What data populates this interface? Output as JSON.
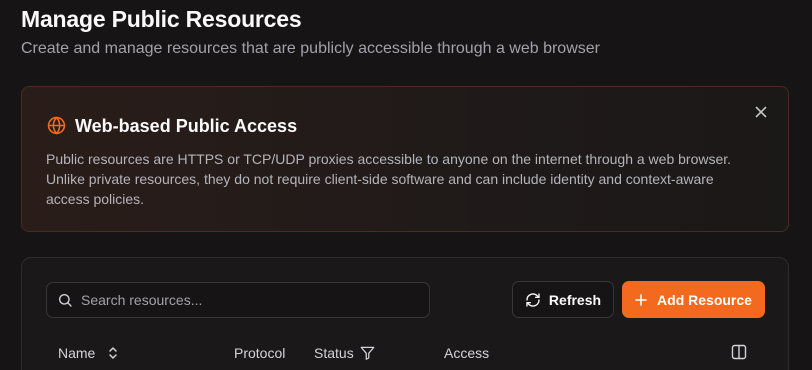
{
  "header": {
    "title": "Manage Public Resources",
    "subtitle": "Create and manage resources that are publicly accessible through a web browser"
  },
  "info_card": {
    "icon": "globe-icon",
    "title": "Web-based Public Access",
    "body": "Public resources are HTTPS or TCP/UDP proxies accessible to anyone on the internet through a web browser. Unlike private resources, they do not require client-side software and can include identity and context-aware access policies.",
    "close_icon": "close-icon"
  },
  "toolbar": {
    "search_placeholder": "Search resources...",
    "refresh_label": "Refresh",
    "add_label": "Add Resource"
  },
  "table": {
    "columns": [
      {
        "label": "Name",
        "icon": "sort-icon"
      },
      {
        "label": "Protocol"
      },
      {
        "label": "Status",
        "icon": "filter-icon"
      },
      {
        "label": "Access"
      }
    ]
  },
  "colors": {
    "accent": "#f36a1e",
    "background": "#161414"
  }
}
